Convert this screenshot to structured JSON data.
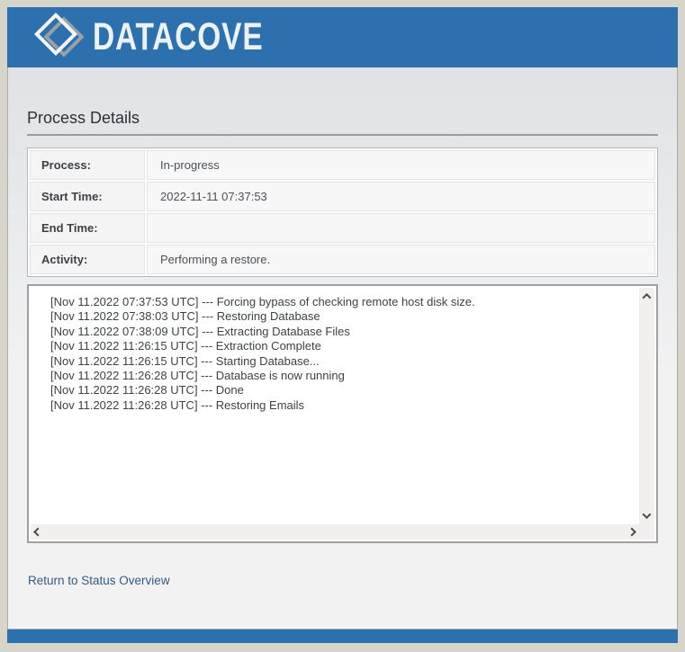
{
  "header": {
    "logo_text": "DATACOVE"
  },
  "page": {
    "title": "Process Details"
  },
  "details": {
    "rows": [
      {
        "label": "Process:",
        "value": "In-progress"
      },
      {
        "label": "Start Time:",
        "value": "2022-11-11 07:37:53"
      },
      {
        "label": "End Time:",
        "value": ""
      },
      {
        "label": "Activity:",
        "value": "Performing a restore."
      }
    ]
  },
  "log": {
    "lines": [
      "[Nov 11.2022 07:37:53 UTC] --- Forcing bypass of checking remote host disk size.",
      "[Nov 11.2022 07:38:03 UTC] --- Restoring Database",
      "[Nov 11.2022 07:38:09 UTC] --- Extracting Database Files",
      "[Nov 11.2022 11:26:15 UTC] --- Extraction Complete",
      "[Nov 11.2022 11:26:15 UTC] --- Starting Database...",
      "[Nov 11.2022 11:26:28 UTC] --- Database is now running",
      "[Nov 11.2022 11:26:28 UTC] --- Done",
      "[Nov 11.2022 11:26:28 UTC] --- Restoring Emails"
    ]
  },
  "footer": {
    "return_link": "Return to Status Overview"
  },
  "icons": {
    "logo": "datacove-diamond-icon",
    "scroll_up": "chevron-up-icon",
    "scroll_down": "chevron-down-icon",
    "scroll_left": "chevron-left-icon",
    "scroll_right": "chevron-right-icon"
  },
  "colors": {
    "brand_blue": "#2c70ae",
    "page_background": "#d7d4cb",
    "panel_background": "#f2f2f3",
    "link": "#36597f"
  }
}
